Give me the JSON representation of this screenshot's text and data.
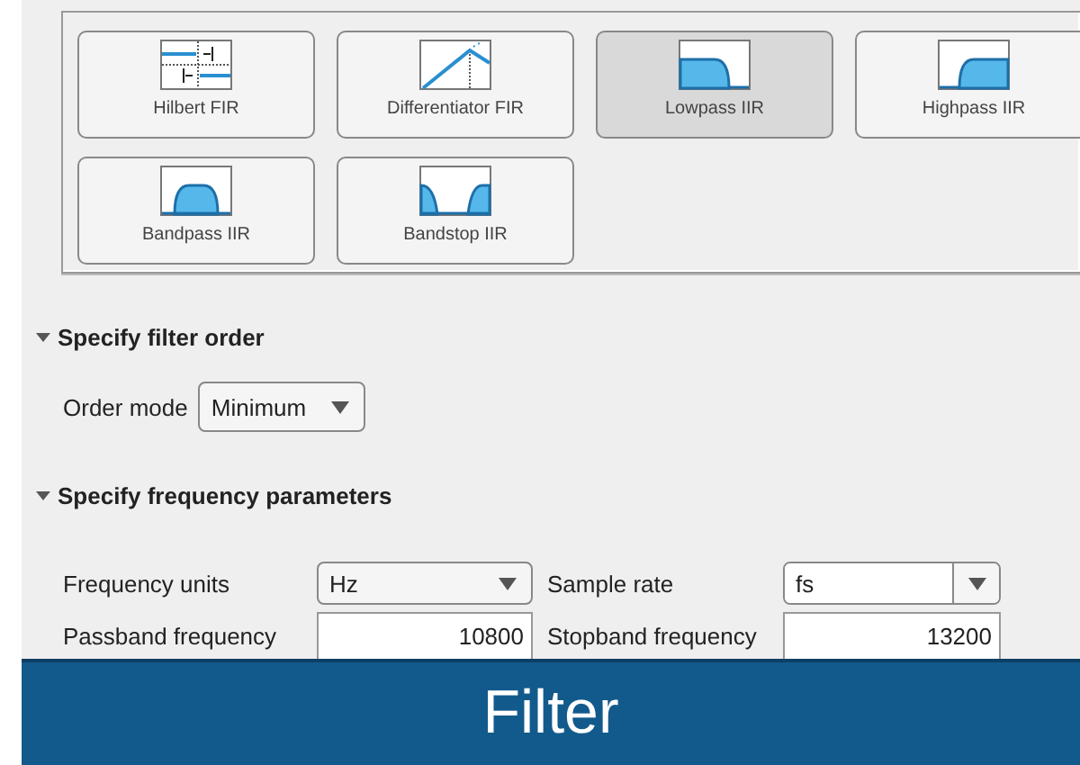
{
  "gallery": {
    "items": [
      {
        "label": "Hilbert FIR",
        "kind": "hilbert",
        "selected": false
      },
      {
        "label": "Differentiator FIR",
        "kind": "differentiator",
        "selected": false
      },
      {
        "label": "Lowpass IIR",
        "kind": "lowpass",
        "selected": true
      },
      {
        "label": "Highpass IIR",
        "kind": "highpass",
        "selected": false
      },
      {
        "label": "Bandpass IIR",
        "kind": "bandpass",
        "selected": false
      },
      {
        "label": "Bandstop IIR",
        "kind": "bandstop",
        "selected": false
      }
    ]
  },
  "sections": [
    {
      "title": "Specify filter order",
      "expanded": true,
      "fields": [
        {
          "label": "Order mode",
          "kind": "dropdown",
          "value": "Minimum"
        }
      ]
    },
    {
      "title": "Specify frequency parameters",
      "expanded": true,
      "fields": [
        {
          "label": "Frequency units",
          "kind": "dropdown",
          "value": "Hz"
        },
        {
          "label": "Sample rate",
          "kind": "combo",
          "value": "fs"
        },
        {
          "label": "Passband frequency",
          "kind": "number",
          "value": "10800"
        },
        {
          "label": "Stopband frequency",
          "kind": "number",
          "value": "13200"
        }
      ]
    }
  ],
  "banner": {
    "title": "Filter"
  }
}
